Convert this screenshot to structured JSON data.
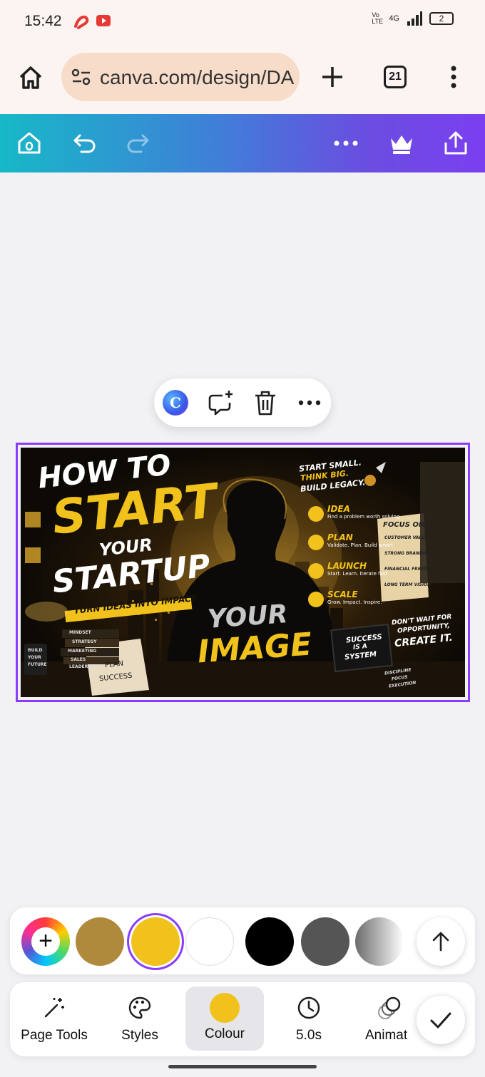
{
  "status_bar": {
    "time": "15:42",
    "network": "4G",
    "volte": "Vo LTE",
    "battery": "2"
  },
  "browser": {
    "url": "canva.com/design/DA",
    "tab_count": "21"
  },
  "design": {
    "title_line1": "HOW TO",
    "title_line2": "START",
    "title_line3": "YOUR",
    "title_line4": "STARTUP",
    "tagline": "TURN IDEAS INTO IMPACT",
    "hoodie_line1": "YOUR",
    "hoodie_line2": "IMAGE",
    "motto1": "START SMALL.",
    "motto2": "THINK BIG.",
    "motto3": "BUILD LEGACY.",
    "steps": [
      {
        "title": "IDEA",
        "desc": "Find a problem worth solving"
      },
      {
        "title": "PLAN",
        "desc": "Validate. Plan. Build smart"
      },
      {
        "title": "LAUNCH",
        "desc": "Start. Learn. Iterate fast"
      },
      {
        "title": "SCALE",
        "desc": "Grow. Impact. Inspire."
      }
    ],
    "focus_title": "FOCUS ON:",
    "focus_items": [
      "CUSTOMER VALUE",
      "STRONG BRANDING",
      "FINANCIAL FREEDOM",
      "LONG TERM VISION"
    ],
    "dont_wait1": "DON'T WAIT FOR",
    "dont_wait2": "OPPORTUNITY,",
    "create_it": "CREATE IT.",
    "laptop1": "SUCCESS",
    "laptop2": "IS A",
    "laptop3": "SYSTEM",
    "books": [
      "MINDSET",
      "STRATEGY",
      "MARKETING",
      "SALES",
      "LEADERSHIP"
    ],
    "notebook": [
      "IDEA",
      "PLAN",
      "SUCCESS"
    ],
    "mug": [
      "BUILD",
      "YOUR",
      "FUTURE"
    ],
    "book_right": [
      "DISCIPLINE",
      "FOCUS",
      "EXECUTION"
    ]
  },
  "palette": {
    "colors": [
      "#b08a3c",
      "#f0c21b",
      "#ffffff",
      "#000000",
      "#555555"
    ],
    "selected": "#f0c21b",
    "gradient_colors": [
      "#6b6b6b",
      "#ffffff"
    ]
  },
  "toolbar": {
    "items": [
      {
        "label": "Page Tools",
        "icon": "magic-wand-icon"
      },
      {
        "label": "Styles",
        "icon": "palette-icon"
      },
      {
        "label": "Colour",
        "icon": "color-swatch-icon"
      },
      {
        "label": "5.0s",
        "icon": "clock-icon"
      },
      {
        "label": "Animat",
        "icon": "animate-icon"
      }
    ],
    "active_index": 2,
    "active_color": "#f0c21b"
  }
}
